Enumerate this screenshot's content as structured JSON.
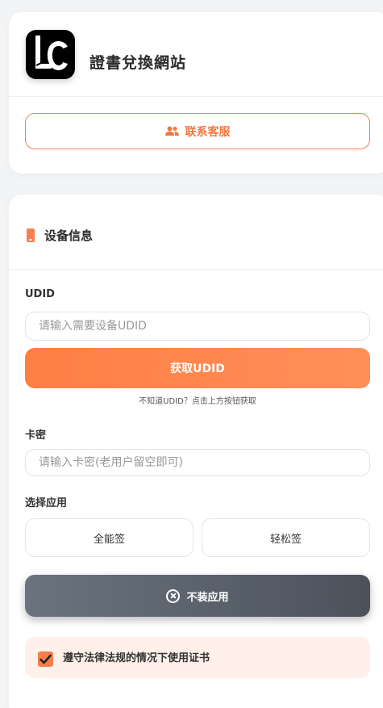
{
  "header": {
    "title": "證書兌換網站",
    "logo_text": "LC",
    "contact_button_label": "联系客服"
  },
  "device_section": {
    "title": "设备信息",
    "udid_label": "UDID",
    "udid_placeholder": "请输入需要设备UDID",
    "udid_value": "",
    "get_udid_button_label": "获取UDID",
    "udid_hint": "不知道UDID？点击上方按钮获取",
    "card_label": "卡密",
    "card_placeholder": "请输入卡密(老用户留空即可)",
    "card_value": "",
    "app_select_label": "选择应用",
    "app_options": [
      "全能签",
      "轻松签"
    ],
    "install_button_label": "不装应用",
    "agreement_text": "遵守法律法规的情况下使用证书",
    "agreement_checked": true
  },
  "colors": {
    "accent": "#ff7e45",
    "dark_button": "#4b525c",
    "agreement_bg": "#fff0ea"
  }
}
